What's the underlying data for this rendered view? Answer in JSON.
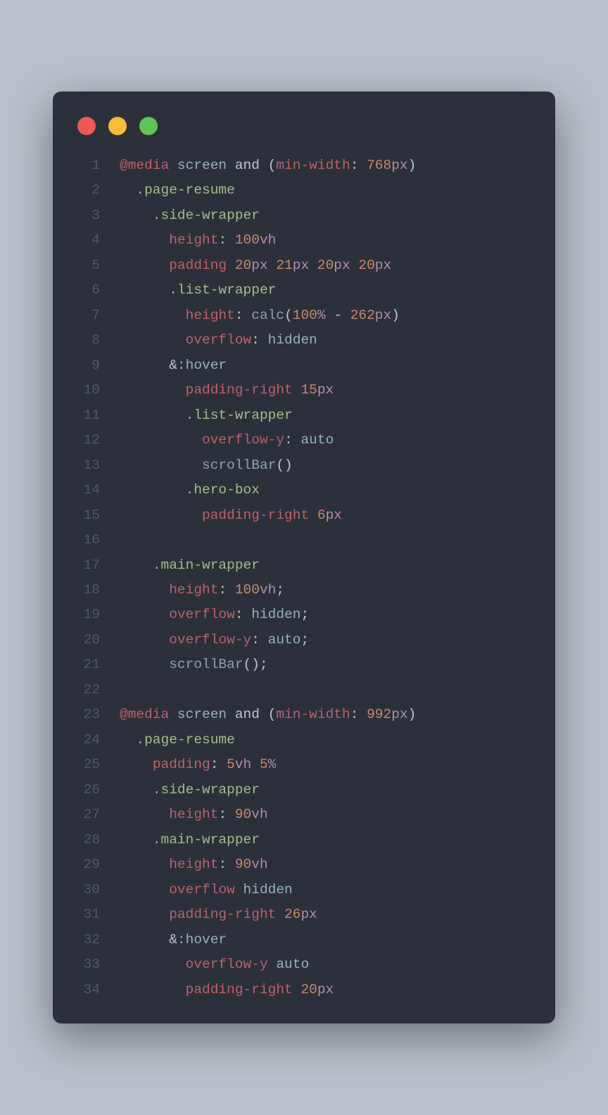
{
  "traffic_lights": {
    "close": "close",
    "minimize": "minimize",
    "maximize": "maximize"
  },
  "editor": {
    "lines": [
      {
        "num": "1",
        "indent": 0,
        "tokens": [
          {
            "t": "@media",
            "c": "at"
          },
          {
            "t": " ",
            "c": "txt"
          },
          {
            "t": "screen",
            "c": "kw"
          },
          {
            "t": " ",
            "c": "txt"
          },
          {
            "t": "and",
            "c": "op"
          },
          {
            "t": " (",
            "c": "paren"
          },
          {
            "t": "min-width",
            "c": "prop"
          },
          {
            "t": ": ",
            "c": "op"
          },
          {
            "t": "768",
            "c": "num"
          },
          {
            "t": "px",
            "c": "unit"
          },
          {
            "t": ")",
            "c": "paren"
          }
        ]
      },
      {
        "num": "2",
        "indent": 1,
        "tokens": [
          {
            "t": ".page-resume",
            "c": "sel"
          }
        ]
      },
      {
        "num": "3",
        "indent": 2,
        "tokens": [
          {
            "t": ".side-wrapper",
            "c": "sel"
          }
        ]
      },
      {
        "num": "4",
        "indent": 3,
        "tokens": [
          {
            "t": "height",
            "c": "prop"
          },
          {
            "t": ": ",
            "c": "op"
          },
          {
            "t": "100",
            "c": "num"
          },
          {
            "t": "vh",
            "c": "unit"
          }
        ]
      },
      {
        "num": "5",
        "indent": 3,
        "tokens": [
          {
            "t": "padding",
            "c": "prop"
          },
          {
            "t": " ",
            "c": "txt"
          },
          {
            "t": "20",
            "c": "num"
          },
          {
            "t": "px",
            "c": "unit"
          },
          {
            "t": " ",
            "c": "txt"
          },
          {
            "t": "21",
            "c": "num"
          },
          {
            "t": "px",
            "c": "unit"
          },
          {
            "t": " ",
            "c": "txt"
          },
          {
            "t": "20",
            "c": "num"
          },
          {
            "t": "px",
            "c": "unit"
          },
          {
            "t": " ",
            "c": "txt"
          },
          {
            "t": "20",
            "c": "num"
          },
          {
            "t": "px",
            "c": "unit"
          }
        ]
      },
      {
        "num": "6",
        "indent": 3,
        "tokens": [
          {
            "t": ".list-wrapper",
            "c": "sel"
          }
        ]
      },
      {
        "num": "7",
        "indent": 4,
        "tokens": [
          {
            "t": "height",
            "c": "prop"
          },
          {
            "t": ": ",
            "c": "op"
          },
          {
            "t": "calc",
            "c": "fn"
          },
          {
            "t": "(",
            "c": "paren"
          },
          {
            "t": "100",
            "c": "num"
          },
          {
            "t": "%",
            "c": "unit"
          },
          {
            "t": " - ",
            "c": "op"
          },
          {
            "t": "262",
            "c": "num"
          },
          {
            "t": "px",
            "c": "unit"
          },
          {
            "t": ")",
            "c": "paren"
          }
        ]
      },
      {
        "num": "8",
        "indent": 4,
        "tokens": [
          {
            "t": "overflow",
            "c": "prop"
          },
          {
            "t": ": ",
            "c": "op"
          },
          {
            "t": "hidden",
            "c": "kw"
          }
        ]
      },
      {
        "num": "9",
        "indent": 3,
        "tokens": [
          {
            "t": "&",
            "c": "op"
          },
          {
            "t": ":hover",
            "c": "kw"
          }
        ]
      },
      {
        "num": "10",
        "indent": 4,
        "tokens": [
          {
            "t": "padding-right",
            "c": "prop"
          },
          {
            "t": " ",
            "c": "txt"
          },
          {
            "t": "15",
            "c": "num"
          },
          {
            "t": "px",
            "c": "unit"
          }
        ]
      },
      {
        "num": "11",
        "indent": 4,
        "tokens": [
          {
            "t": ".list-wrapper",
            "c": "sel"
          }
        ]
      },
      {
        "num": "12",
        "indent": 5,
        "tokens": [
          {
            "t": "overflow-y",
            "c": "prop"
          },
          {
            "t": ": ",
            "c": "op"
          },
          {
            "t": "auto",
            "c": "kw"
          }
        ]
      },
      {
        "num": "13",
        "indent": 5,
        "tokens": [
          {
            "t": "scrollBar",
            "c": "fn"
          },
          {
            "t": "()",
            "c": "paren"
          }
        ]
      },
      {
        "num": "14",
        "indent": 4,
        "tokens": [
          {
            "t": ".hero-box",
            "c": "sel"
          }
        ]
      },
      {
        "num": "15",
        "indent": 5,
        "tokens": [
          {
            "t": "padding-right",
            "c": "prop"
          },
          {
            "t": " ",
            "c": "txt"
          },
          {
            "t": "6",
            "c": "num"
          },
          {
            "t": "px",
            "c": "unit"
          }
        ]
      },
      {
        "num": "16",
        "indent": 0,
        "tokens": []
      },
      {
        "num": "17",
        "indent": 2,
        "tokens": [
          {
            "t": ".main-wrapper",
            "c": "sel"
          }
        ]
      },
      {
        "num": "18",
        "indent": 3,
        "tokens": [
          {
            "t": "height",
            "c": "prop"
          },
          {
            "t": ": ",
            "c": "op"
          },
          {
            "t": "100",
            "c": "num"
          },
          {
            "t": "vh",
            "c": "unit"
          },
          {
            "t": ";",
            "c": "op"
          }
        ]
      },
      {
        "num": "19",
        "indent": 3,
        "tokens": [
          {
            "t": "overflow",
            "c": "prop"
          },
          {
            "t": ": ",
            "c": "op"
          },
          {
            "t": "hidden",
            "c": "kw"
          },
          {
            "t": ";",
            "c": "op"
          }
        ]
      },
      {
        "num": "20",
        "indent": 3,
        "tokens": [
          {
            "t": "overflow-y",
            "c": "prop"
          },
          {
            "t": ": ",
            "c": "op"
          },
          {
            "t": "auto",
            "c": "kw"
          },
          {
            "t": ";",
            "c": "op"
          }
        ]
      },
      {
        "num": "21",
        "indent": 3,
        "tokens": [
          {
            "t": "scrollBar",
            "c": "fn"
          },
          {
            "t": "();",
            "c": "paren"
          }
        ]
      },
      {
        "num": "22",
        "indent": 0,
        "tokens": []
      },
      {
        "num": "23",
        "indent": 0,
        "tokens": [
          {
            "t": "@media",
            "c": "at"
          },
          {
            "t": " ",
            "c": "txt"
          },
          {
            "t": "screen",
            "c": "kw"
          },
          {
            "t": " ",
            "c": "txt"
          },
          {
            "t": "and",
            "c": "op"
          },
          {
            "t": " (",
            "c": "paren"
          },
          {
            "t": "min-width",
            "c": "prop"
          },
          {
            "t": ": ",
            "c": "op"
          },
          {
            "t": "992",
            "c": "num"
          },
          {
            "t": "px",
            "c": "unit"
          },
          {
            "t": ")",
            "c": "paren"
          }
        ]
      },
      {
        "num": "24",
        "indent": 1,
        "tokens": [
          {
            "t": ".page-resume",
            "c": "sel"
          }
        ]
      },
      {
        "num": "25",
        "indent": 2,
        "tokens": [
          {
            "t": "padding",
            "c": "prop"
          },
          {
            "t": ": ",
            "c": "op"
          },
          {
            "t": "5",
            "c": "num"
          },
          {
            "t": "vh",
            "c": "unit"
          },
          {
            "t": " ",
            "c": "txt"
          },
          {
            "t": "5",
            "c": "num"
          },
          {
            "t": "%",
            "c": "unit"
          }
        ]
      },
      {
        "num": "26",
        "indent": 2,
        "tokens": [
          {
            "t": ".side-wrapper",
            "c": "sel"
          }
        ]
      },
      {
        "num": "27",
        "indent": 3,
        "tokens": [
          {
            "t": "height",
            "c": "prop"
          },
          {
            "t": ": ",
            "c": "op"
          },
          {
            "t": "90",
            "c": "num"
          },
          {
            "t": "vh",
            "c": "unit"
          }
        ]
      },
      {
        "num": "28",
        "indent": 2,
        "tokens": [
          {
            "t": ".main-wrapper",
            "c": "sel"
          }
        ]
      },
      {
        "num": "29",
        "indent": 3,
        "tokens": [
          {
            "t": "height",
            "c": "prop"
          },
          {
            "t": ": ",
            "c": "op"
          },
          {
            "t": "90",
            "c": "num"
          },
          {
            "t": "vh",
            "c": "unit"
          }
        ]
      },
      {
        "num": "30",
        "indent": 3,
        "tokens": [
          {
            "t": "overflow",
            "c": "prop"
          },
          {
            "t": " ",
            "c": "txt"
          },
          {
            "t": "hidden",
            "c": "kw"
          }
        ]
      },
      {
        "num": "31",
        "indent": 3,
        "tokens": [
          {
            "t": "padding-right",
            "c": "prop"
          },
          {
            "t": " ",
            "c": "txt"
          },
          {
            "t": "26",
            "c": "num"
          },
          {
            "t": "px",
            "c": "unit"
          }
        ]
      },
      {
        "num": "32",
        "indent": 3,
        "tokens": [
          {
            "t": "&",
            "c": "op"
          },
          {
            "t": ":hover",
            "c": "kw"
          }
        ]
      },
      {
        "num": "33",
        "indent": 4,
        "tokens": [
          {
            "t": "overflow-y",
            "c": "prop"
          },
          {
            "t": " ",
            "c": "txt"
          },
          {
            "t": "auto",
            "c": "kw"
          }
        ]
      },
      {
        "num": "34",
        "indent": 4,
        "tokens": [
          {
            "t": "padding-right",
            "c": "prop"
          },
          {
            "t": " ",
            "c": "txt"
          },
          {
            "t": "20",
            "c": "num"
          },
          {
            "t": "px",
            "c": "unit"
          }
        ]
      }
    ]
  }
}
